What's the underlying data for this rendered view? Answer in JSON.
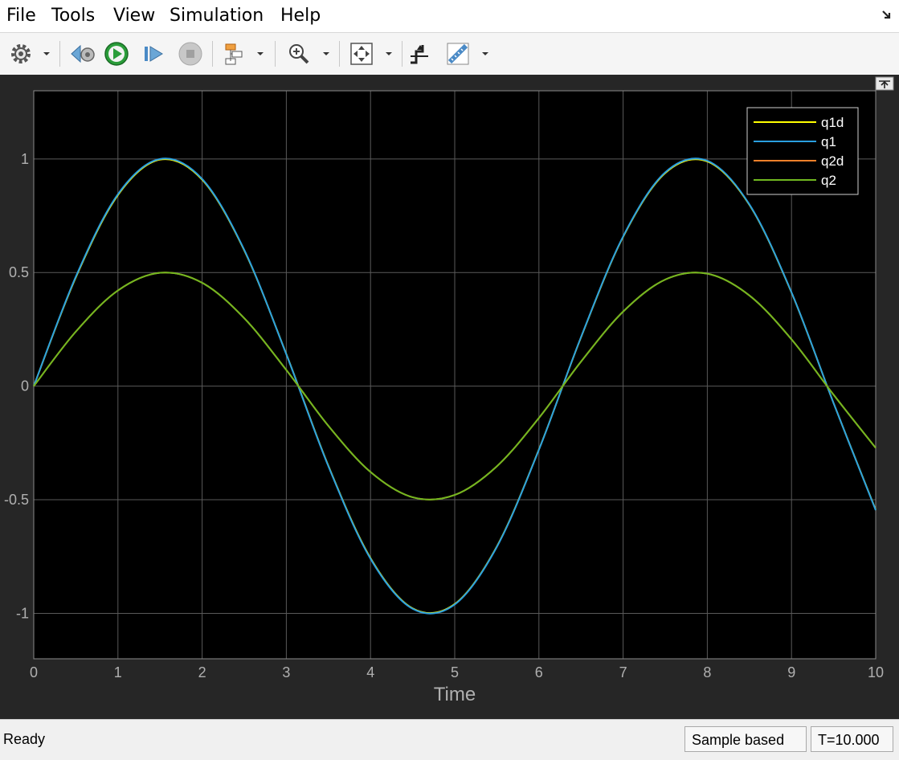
{
  "menu": [
    "File",
    "Tools",
    "View",
    "Simulation",
    "Help"
  ],
  "toolbar": {
    "icons": [
      "gear-icon",
      "step-back-icon",
      "run-icon",
      "step-forward-icon",
      "stop-icon",
      "highlight-model-icon",
      "zoom-icon",
      "fit-to-view-icon",
      "triggers-icon",
      "cursor-measurements-icon"
    ]
  },
  "status": {
    "text": "Ready",
    "sample_mode": "Sample based",
    "time": "T=10.000"
  },
  "colors": {
    "plot_background": "#000000",
    "frame_background": "#262626",
    "grid": "#5a5a5a",
    "tick_label": "#b0b0b0",
    "q1d": "#ffff00",
    "q1": "#2a9fe0",
    "q2d": "#f5802a",
    "q2": "#70b820"
  },
  "chart_data": {
    "type": "line",
    "xlabel": "Time",
    "ylabel": "",
    "title": "",
    "xlim": [
      0,
      10
    ],
    "ylim": [
      -1.2,
      1.3
    ],
    "xticks": [
      "0",
      "1",
      "2",
      "3",
      "4",
      "5",
      "6",
      "7",
      "8",
      "9",
      "10"
    ],
    "yticks": [
      "-1",
      "-0.5",
      "0",
      "0.5",
      "1"
    ],
    "grid": true,
    "legend_position": "top-right",
    "x": [
      0,
      0.5,
      1,
      1.5,
      2,
      2.5,
      3,
      3.5,
      4,
      4.5,
      5,
      5.5,
      6,
      6.5,
      7,
      7.5,
      8,
      8.5,
      9,
      9.5,
      10
    ],
    "series": [
      {
        "name": "q1d",
        "values": [
          0,
          0.479,
          0.841,
          0.997,
          0.909,
          0.598,
          0.141,
          -0.351,
          -0.757,
          -0.978,
          -0.959,
          -0.706,
          -0.279,
          0.215,
          0.657,
          0.938,
          0.989,
          0.798,
          0.412,
          -0.075,
          -0.544
        ]
      },
      {
        "name": "q1",
        "values": [
          0,
          0.482,
          0.845,
          1.0,
          0.912,
          0.6,
          0.14,
          -0.353,
          -0.76,
          -0.98,
          -0.961,
          -0.708,
          -0.28,
          0.216,
          0.659,
          0.941,
          0.992,
          0.8,
          0.413,
          -0.075,
          -0.546
        ]
      },
      {
        "name": "q2d",
        "values": [
          0,
          0.24,
          0.421,
          0.499,
          0.455,
          0.299,
          0.071,
          -0.175,
          -0.378,
          -0.489,
          -0.479,
          -0.353,
          -0.14,
          0.108,
          0.328,
          0.469,
          0.495,
          0.399,
          0.206,
          -0.038,
          -0.272
        ]
      },
      {
        "name": "q2",
        "values": [
          0,
          0.24,
          0.421,
          0.499,
          0.455,
          0.299,
          0.071,
          -0.175,
          -0.378,
          -0.489,
          -0.479,
          -0.353,
          -0.14,
          0.108,
          0.328,
          0.469,
          0.495,
          0.399,
          0.206,
          -0.038,
          -0.272
        ]
      }
    ]
  }
}
